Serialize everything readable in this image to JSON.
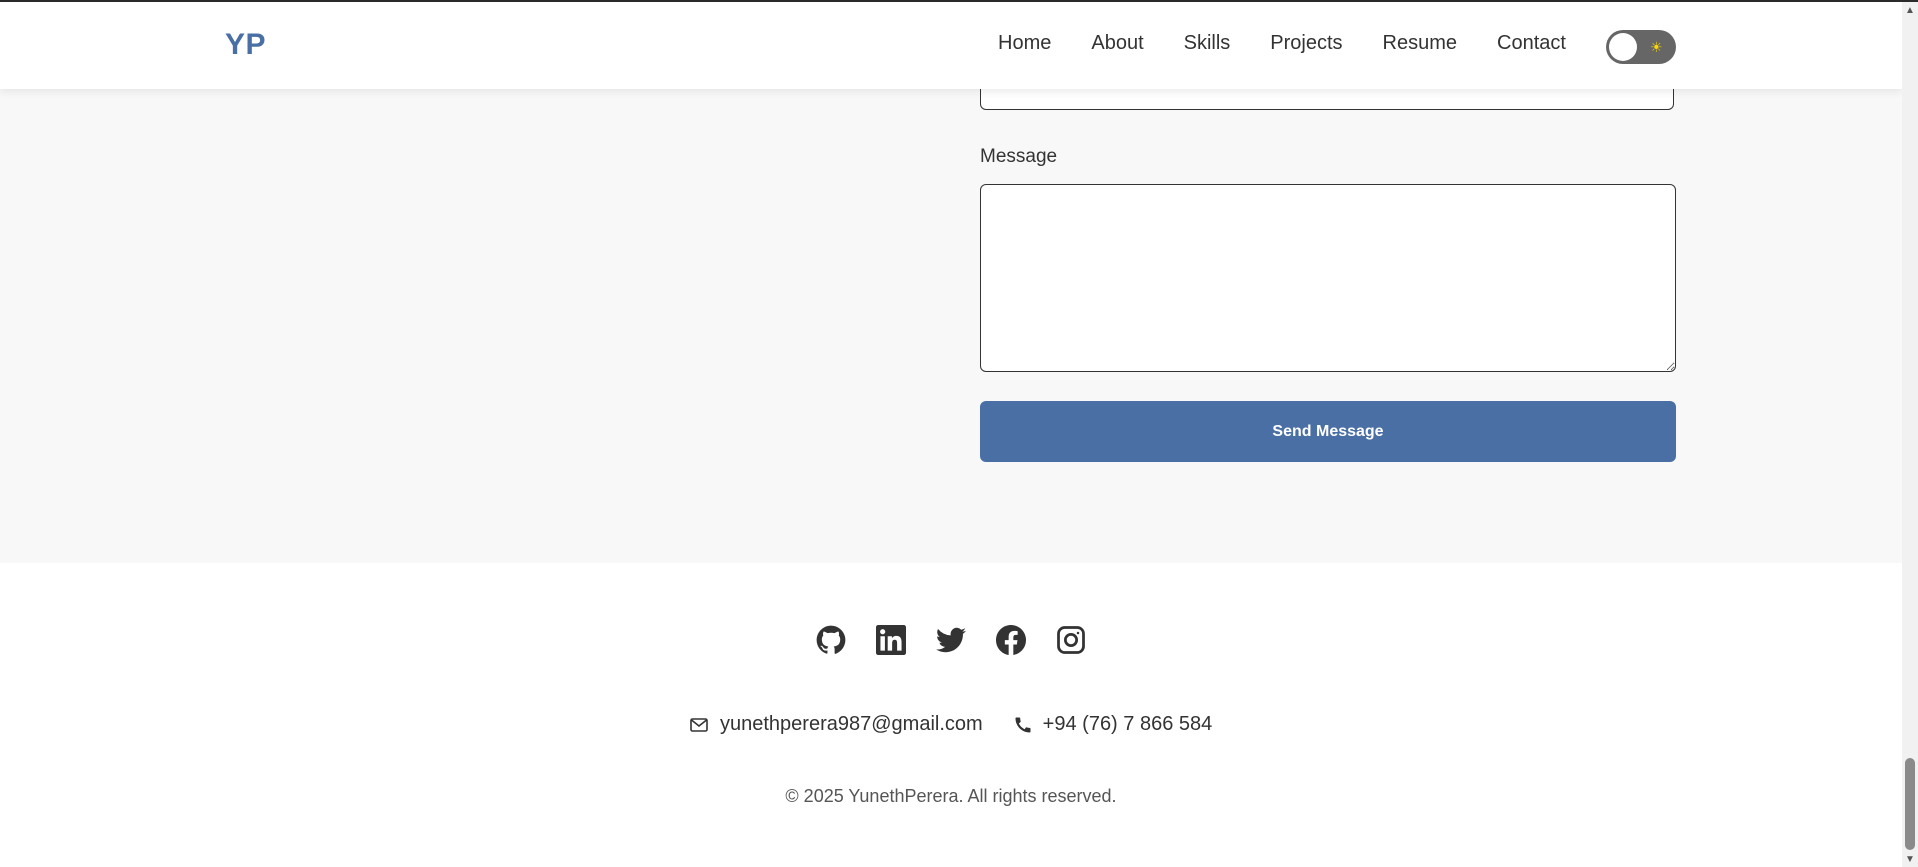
{
  "navbar": {
    "logo": "YP",
    "links": [
      "Home",
      "About",
      "Skills",
      "Projects",
      "Resume",
      "Contact"
    ],
    "theme_toggle_icon": "sun-icon"
  },
  "contact_form": {
    "message_label": "Message",
    "message_value": "",
    "send_button_label": "Send Message",
    "accent_color": "#4a6fa5"
  },
  "footer": {
    "social_icons": [
      "github-icon",
      "linkedin-icon",
      "twitter-icon",
      "facebook-icon",
      "instagram-icon"
    ],
    "email": "yunethperera987@gmail.com",
    "phone": "+94 (76) 7 866 584",
    "copyright": "© 2025 YunethPerera. All rights reserved."
  }
}
